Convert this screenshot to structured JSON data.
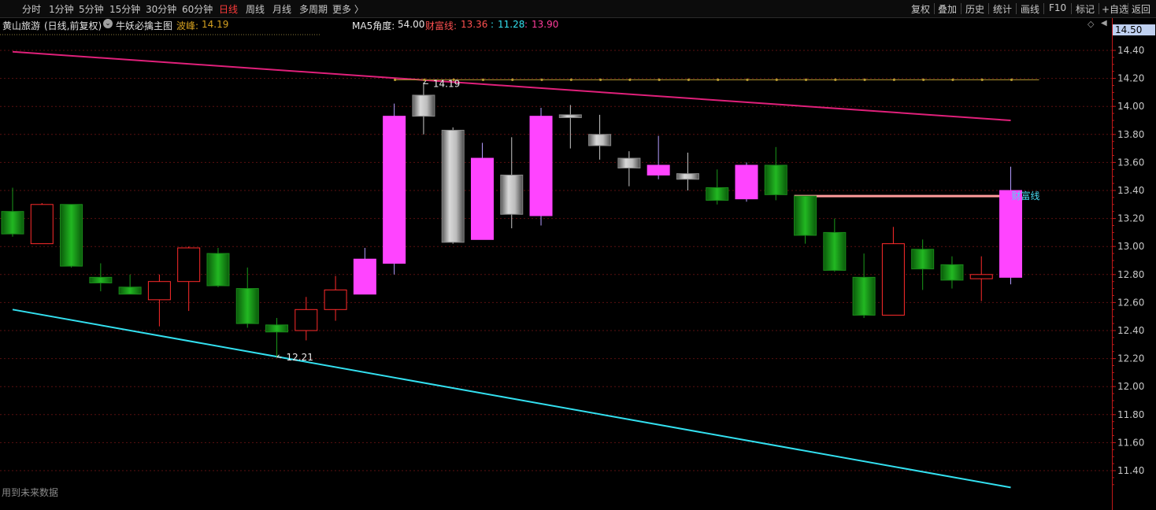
{
  "toolbar": {
    "periods": [
      "分时",
      "1分钟",
      "5分钟",
      "15分钟",
      "30分钟",
      "60分钟",
      "日线",
      "周线",
      "月线",
      "多周期",
      "更多 〉"
    ],
    "active_period": "日线",
    "actions": [
      "复权",
      "叠加",
      "历史",
      "统计",
      "画线",
      "F10",
      "标记",
      "+自选",
      "返回"
    ]
  },
  "info": {
    "stock": "黄山旅游",
    "mode": "(日线,前复权)",
    "indicator": "牛妖必擒主图",
    "peak_label": "波峰:",
    "peak_value": "14.19",
    "ma5_label": "MA5角度:",
    "ma5_value": "54.00",
    "wealth_label": "财富线:",
    "wealth_value": "13.36",
    "val2": "11.28",
    "val3": "13.90"
  },
  "axis": {
    "current_price": "14.50",
    "ticks": [
      "14.40",
      "14.20",
      "14.00",
      "13.80",
      "13.60",
      "13.40",
      "13.20",
      "13.00",
      "12.80",
      "12.60",
      "12.40",
      "12.20",
      "12.00",
      "11.80",
      "11.60",
      "11.40"
    ]
  },
  "annotations": {
    "high_label": "14.19",
    "low_label": "12.21",
    "wealth_line_label": "财富线",
    "future_data_note": "用到未来数据"
  },
  "colors": {
    "up_red": "#ff2b2b",
    "down_green": "#17a317",
    "magenta": "#ff44ff",
    "gray": "#9a9a9a",
    "upper_line": "#e0207a",
    "lower_line": "#33e0f0",
    "peak_line": "#b89a30",
    "wealth_line": "#ff9b9b"
  },
  "chart_data": {
    "type": "candlestick",
    "ylim": [
      11.2,
      14.5
    ],
    "candles": [
      {
        "o": 13.25,
        "h": 13.42,
        "l": 13.07,
        "c": 13.09,
        "col": "green"
      },
      {
        "o": 13.02,
        "h": 13.31,
        "l": 13.02,
        "c": 13.3,
        "col": "red"
      },
      {
        "o": 13.3,
        "h": 13.3,
        "l": 12.85,
        "c": 12.86,
        "col": "green"
      },
      {
        "o": 12.78,
        "h": 12.88,
        "l": 12.68,
        "c": 12.74,
        "col": "green"
      },
      {
        "o": 12.71,
        "h": 12.8,
        "l": 12.66,
        "c": 12.66,
        "col": "green"
      },
      {
        "o": 12.62,
        "h": 12.8,
        "l": 12.43,
        "c": 12.75,
        "col": "red"
      },
      {
        "o": 12.75,
        "h": 13.0,
        "l": 12.54,
        "c": 12.99,
        "col": "red"
      },
      {
        "o": 12.95,
        "h": 12.99,
        "l": 12.71,
        "c": 12.72,
        "col": "green"
      },
      {
        "o": 12.7,
        "h": 12.85,
        "l": 12.42,
        "c": 12.45,
        "col": "green"
      },
      {
        "o": 12.44,
        "h": 12.49,
        "l": 12.21,
        "c": 12.39,
        "col": "green"
      },
      {
        "o": 12.4,
        "h": 12.64,
        "l": 12.33,
        "c": 12.55,
        "col": "red"
      },
      {
        "o": 12.55,
        "h": 12.79,
        "l": 12.47,
        "c": 12.69,
        "col": "red"
      },
      {
        "o": 12.66,
        "h": 12.99,
        "l": 12.66,
        "c": 12.91,
        "col": "magenta"
      },
      {
        "o": 12.88,
        "h": 14.02,
        "l": 12.8,
        "c": 13.93,
        "col": "magenta"
      },
      {
        "o": 13.93,
        "h": 14.17,
        "l": 13.8,
        "c": 14.08,
        "col": "gray"
      },
      {
        "o": 13.83,
        "h": 13.85,
        "l": 13.02,
        "c": 13.03,
        "col": "gray"
      },
      {
        "o": 13.05,
        "h": 13.74,
        "l": 13.05,
        "c": 13.63,
        "col": "magenta"
      },
      {
        "o": 13.51,
        "h": 13.78,
        "l": 13.13,
        "c": 13.23,
        "col": "gray"
      },
      {
        "o": 13.22,
        "h": 13.99,
        "l": 13.15,
        "c": 13.93,
        "col": "magenta"
      },
      {
        "o": 13.94,
        "h": 14.01,
        "l": 13.7,
        "c": 13.92,
        "col": "gray"
      },
      {
        "o": 13.8,
        "h": 13.94,
        "l": 13.62,
        "c": 13.72,
        "col": "gray"
      },
      {
        "o": 13.63,
        "h": 13.68,
        "l": 13.43,
        "c": 13.56,
        "col": "gray"
      },
      {
        "o": 13.51,
        "h": 13.79,
        "l": 13.48,
        "c": 13.58,
        "col": "magenta"
      },
      {
        "o": 13.52,
        "h": 13.67,
        "l": 13.4,
        "c": 13.48,
        "col": "gray"
      },
      {
        "o": 13.42,
        "h": 13.55,
        "l": 13.3,
        "c": 13.33,
        "col": "green"
      },
      {
        "o": 13.34,
        "h": 13.6,
        "l": 13.32,
        "c": 13.58,
        "col": "magenta"
      },
      {
        "o": 13.58,
        "h": 13.71,
        "l": 13.33,
        "c": 13.37,
        "col": "green"
      },
      {
        "o": 13.36,
        "h": 13.36,
        "l": 13.02,
        "c": 13.08,
        "col": "green"
      },
      {
        "o": 13.1,
        "h": 13.2,
        "l": 12.82,
        "c": 12.83,
        "col": "green"
      },
      {
        "o": 12.78,
        "h": 12.95,
        "l": 12.49,
        "c": 12.51,
        "col": "green"
      },
      {
        "o": 12.51,
        "h": 13.14,
        "l": 12.51,
        "c": 13.02,
        "col": "red"
      },
      {
        "o": 12.98,
        "h": 13.05,
        "l": 12.69,
        "c": 12.84,
        "col": "green"
      },
      {
        "o": 12.87,
        "h": 12.93,
        "l": 12.7,
        "c": 12.76,
        "col": "green"
      },
      {
        "o": 12.77,
        "h": 12.93,
        "l": 12.61,
        "c": 12.8,
        "col": "red"
      },
      {
        "o": 12.78,
        "h": 13.57,
        "l": 12.73,
        "c": 13.4,
        "col": "magenta"
      }
    ],
    "upper_line": {
      "start": 14.39,
      "end": 13.9
    },
    "lower_line": {
      "start": 12.55,
      "end": 11.28
    },
    "peak_line": 14.19,
    "wealth_line": 13.36
  }
}
